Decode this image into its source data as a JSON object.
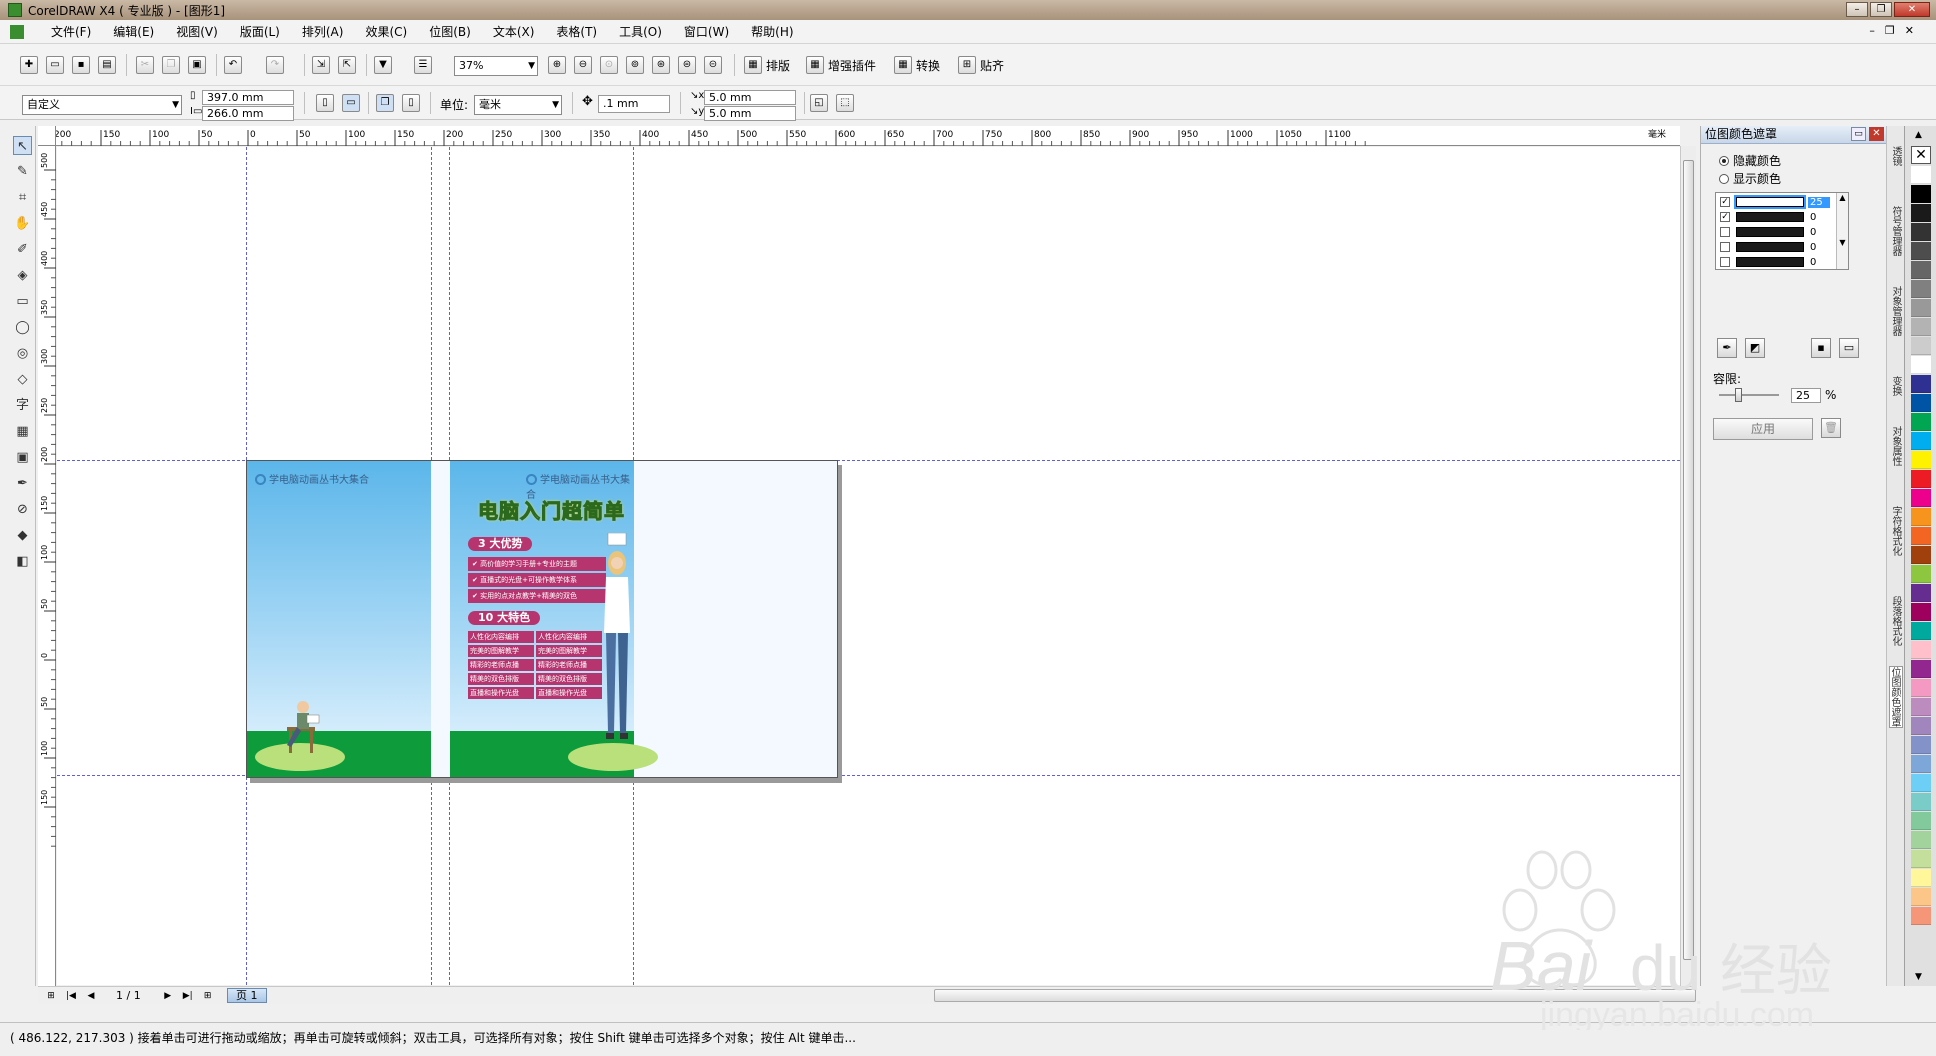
{
  "window": {
    "title": "CorelDRAW X4 ( 专业版 ) - [图形1]"
  },
  "menu": [
    {
      "label": "文件(F)"
    },
    {
      "label": "编辑(E)"
    },
    {
      "label": "视图(V)"
    },
    {
      "label": "版面(L)"
    },
    {
      "label": "排列(A)"
    },
    {
      "label": "效果(C)"
    },
    {
      "label": "位图(B)"
    },
    {
      "label": "文本(X)"
    },
    {
      "label": "表格(T)"
    },
    {
      "label": "工具(O)"
    },
    {
      "label": "窗口(W)"
    },
    {
      "label": "帮助(H)"
    }
  ],
  "standard_toolbar": {
    "zoom": "37%",
    "buttons": {
      "layout": "排版",
      "plugins": "增强插件",
      "convert": "转换",
      "snap": "贴齐"
    }
  },
  "property_bar": {
    "paper_preset": "自定义",
    "width": "397.0 mm",
    "height": "266.0 mm",
    "unit_label": "单位:",
    "unit": "毫米",
    "nudge": ".1 mm",
    "dup_x": "5.0 mm",
    "dup_y": "5.0 mm"
  },
  "ruler": {
    "h_labels": [
      "200",
      "150",
      "100",
      "50",
      "0",
      "50",
      "100",
      "150",
      "200",
      "250",
      "300",
      "350",
      "400",
      "450",
      "500",
      "550",
      "600",
      "650",
      "700",
      "750",
      "800",
      "850",
      "900",
      "950",
      "1000",
      "1050",
      "1100"
    ],
    "h_unit": "毫米",
    "v_labels": [
      "500",
      "450",
      "400",
      "350",
      "300",
      "250",
      "200",
      "150",
      "100",
      "50",
      "0",
      "50",
      "100",
      "150"
    ]
  },
  "artwork": {
    "brand": "学电脑动画丛书大集合",
    "headline": "电脑入门超简单",
    "advantages_title": "3 大优势",
    "advantages": [
      "高价值的学习手册+专业的主题",
      "直播式的光盘+可操作教学体系",
      "实用的点对点教学+精美的双色"
    ],
    "features_title": "10 大特色",
    "features": [
      [
        "人性化内容编排",
        "人性化内容编排"
      ],
      [
        "完美的图解教学",
        "完美的图解教学"
      ],
      [
        "精彩的老师点播",
        "精彩的老师点播"
      ],
      [
        "精美的双色排版",
        "精美的双色排版"
      ],
      [
        "直播和操作光盘",
        "直播和操作光盘"
      ]
    ]
  },
  "page_nav": {
    "counter": "1 / 1",
    "page_tab": "页 1"
  },
  "docker": {
    "title": "位图颜色遮罩",
    "hide_colors": "隐藏颜色",
    "show_colors": "显示颜色",
    "colors": [
      {
        "checked": true,
        "color": "#ffffff",
        "value": "25"
      },
      {
        "checked": true,
        "color": "#1b1b1b",
        "value": "0"
      },
      {
        "checked": false,
        "color": "#1b1b1b",
        "value": "0"
      },
      {
        "checked": false,
        "color": "#1b1b1b",
        "value": "0"
      },
      {
        "checked": false,
        "color": "#1b1b1b",
        "value": "0"
      }
    ],
    "tolerance_label": "容限:",
    "tolerance_value": "25",
    "tolerance_unit": "%",
    "apply": "应用"
  },
  "docker_tabs": [
    "透镜",
    "符号管理器",
    "对象管理器",
    "变换",
    "对象属性",
    "字符格式化",
    "段落格式化",
    "位图颜色遮罩"
  ],
  "palette": [
    "#ffffff",
    "#000000",
    "#1a1a1a",
    "#333333",
    "#4d4d4d",
    "#666666",
    "#808080",
    "#999999",
    "#b3b3b3",
    "#cccccc",
    "#ffffff",
    "#2e3192",
    "#0054a6",
    "#00a651",
    "#00aeef",
    "#fff200",
    "#ed1c24",
    "#ec008c",
    "#f7941d",
    "#f26522",
    "#a0410d",
    "#8dc63f",
    "#662d91",
    "#9e005d",
    "#00a99d",
    "#ffc0cb",
    "#92278f",
    "#f49ac2",
    "#bd8cbf",
    "#a186be",
    "#8393ca",
    "#7da7d9",
    "#6dcff6",
    "#7accc8",
    "#82ca9c",
    "#a3d39c",
    "#c4df9b",
    "#fff799",
    "#fdc689",
    "#f69679"
  ],
  "status": {
    "text": "( 486.122, 217.303 )    接着单击可进行拖动或缩放；再单击可旋转或倾斜；双击工具，可选择所有对象；按住 Shift 键单击可选择多个对象；按住 Alt 键单击..."
  }
}
